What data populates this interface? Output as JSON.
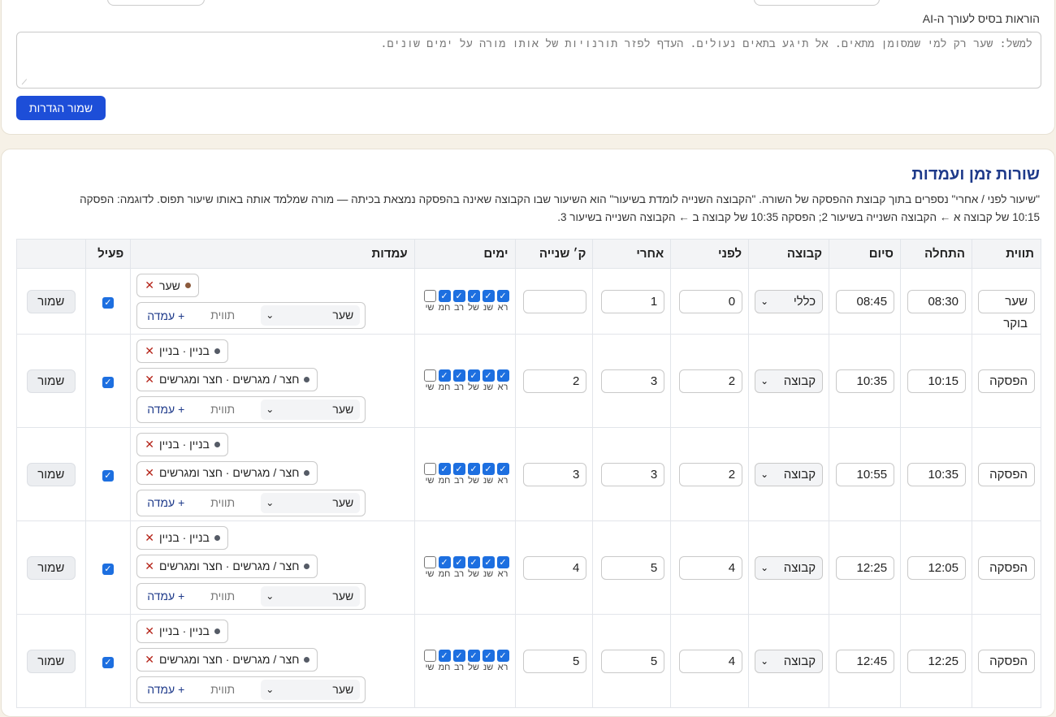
{
  "ai": {
    "label": "הוראות בסיס לעורך ה-AI",
    "placeholder": "למשל: שער רק למי שמסומן מתאים. אל תיגע בתאים נעולים. העדף לפזר תורנויות של אותו מורה על ימים שונים.",
    "save_label": "שמור הגדרות"
  },
  "section": {
    "title": "שורות זמן ועמדות",
    "description_line1": "\"שיעור לפני / אחרי\" נספרים בתוך קבוצת ההפסקה של השורה. \"הקבוצה השנייה לומדת בשיעור\" הוא השיעור שבו הקבוצה שאינה בהפסקה נמצאת בכיתה — מורה שמלמד אותה באותו שיעור תפוס. לדוגמה: הפסקה",
    "description_line2": "10:15 של קבוצה א ← הקבוצה השנייה בשיעור 2; הפסקה 10:35 של קבוצה ב ← הקבוצה השנייה בשיעור 3."
  },
  "table": {
    "headers": [
      "תווית",
      "התחלה",
      "סיום",
      "קבוצה",
      "לפני",
      "אחרי",
      "ק׳ שנייה",
      "ימים",
      "עמדות",
      "פעיל",
      ""
    ],
    "day_names": [
      "רא",
      "שנ",
      "של",
      "רב",
      "חמ",
      "שי"
    ],
    "add_select_value": "שער",
    "add_input_placeholder": "תווית",
    "add_button_label": "+ עמדה",
    "save_row_label": "שמור",
    "rows": [
      {
        "label": "שער בוקר",
        "start": "08:30",
        "end": "08:45",
        "group": "כללי",
        "before": "0",
        "after": "1",
        "second": "",
        "days": [
          true,
          true,
          true,
          true,
          true,
          false
        ],
        "stations": [
          {
            "text": "שער",
            "color": "#8b5a3c"
          }
        ],
        "active": true
      },
      {
        "label": "הפסקה",
        "start": "10:15",
        "end": "10:35",
        "group": "קבוצה",
        "before": "2",
        "after": "3",
        "second": "2",
        "days": [
          true,
          true,
          true,
          true,
          true,
          false
        ],
        "stations": [
          {
            "text": "בניין · בניין",
            "color": "#555b66"
          },
          {
            "text": "חצר / מגרשים · חצר ומגרשים",
            "color": "#555b66"
          }
        ],
        "active": true
      },
      {
        "label": "הפסקה",
        "start": "10:35",
        "end": "10:55",
        "group": "קבוצה",
        "before": "2",
        "after": "3",
        "second": "3",
        "days": [
          true,
          true,
          true,
          true,
          true,
          false
        ],
        "stations": [
          {
            "text": "בניין · בניין",
            "color": "#555b66"
          },
          {
            "text": "חצר / מגרשים · חצר ומגרשים",
            "color": "#555b66"
          }
        ],
        "active": true
      },
      {
        "label": "הפסקה",
        "start": "12:05",
        "end": "12:25",
        "group": "קבוצה",
        "before": "4",
        "after": "5",
        "second": "4",
        "days": [
          true,
          true,
          true,
          true,
          true,
          false
        ],
        "stations": [
          {
            "text": "בניין · בניין",
            "color": "#555b66"
          },
          {
            "text": "חצר / מגרשים · חצר ומגרשים",
            "color": "#555b66"
          }
        ],
        "active": true
      },
      {
        "label": "הפסקה",
        "start": "12:25",
        "end": "12:45",
        "group": "קבוצה",
        "before": "4",
        "after": "5",
        "second": "5",
        "days": [
          true,
          true,
          true,
          true,
          true,
          false
        ],
        "stations": [
          {
            "text": "בניין · בניין",
            "color": "#555b66"
          },
          {
            "text": "חצר / מגרשים · חצר ומגרשים",
            "color": "#555b66"
          }
        ],
        "active": true
      }
    ]
  },
  "colors": {
    "primary": "#1d4ed8",
    "title": "#1e3a8a",
    "checkbox": "#1d6fe0",
    "remove_x": "#b42318"
  }
}
